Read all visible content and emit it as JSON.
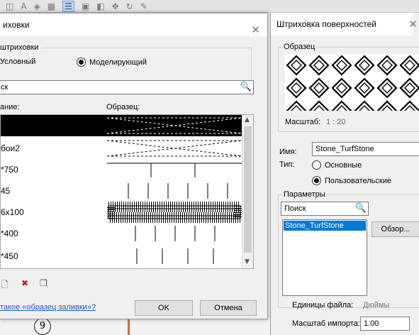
{
  "left_dialog": {
    "title": "иховки",
    "type_group_legend": "штриховки",
    "radio_drafting": "Условный",
    "radio_model": "Моделирующий",
    "search_value": "ск",
    "col_name": "ание:",
    "col_pattern": "Образец:",
    "patterns": [
      {
        "name": "",
        "selected": true
      },
      {
        "name": "бои2",
        "selected": false
      },
      {
        "name": "*750",
        "selected": false
      },
      {
        "name": "45",
        "selected": false
      },
      {
        "name": "6x100",
        "selected": false
      },
      {
        "name": "*400",
        "selected": false
      },
      {
        "name": "*450",
        "selected": false
      }
    ],
    "help_link": "такое «образец заливки»?",
    "ok_label": "OK",
    "cancel_label": "Отмена"
  },
  "right_panel": {
    "title": "Штриховка поверхностей",
    "preview_legend": "Образец",
    "scale_label": "Масштаб:",
    "scale_value": "1 : 20",
    "name_label": "Имя:",
    "name_value": "Stone_TurfStone",
    "type_label": "Тип:",
    "type_basic": "Основные",
    "type_custom": "Пользовательские",
    "params_legend": "Параметры",
    "search_placeholder": "Поиск",
    "list_item": "Stone_TurfStone",
    "browse_label": "Обзор...",
    "units_label": "Единицы файла:",
    "units_value": "Дюймы",
    "import_scale_label": "Масштаб импорта:",
    "import_scale_value": "1.00"
  },
  "background": {
    "toolbar_icons": [
      "layer-icon",
      "text-icon",
      "cube-icon",
      "grid-icon",
      "list-icon",
      "view-icon",
      "section-icon",
      "move-icon",
      "rotate-icon",
      "pen-icon"
    ],
    "circle_label": "9"
  }
}
